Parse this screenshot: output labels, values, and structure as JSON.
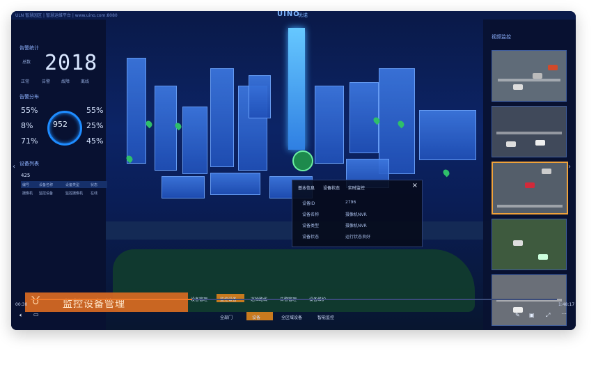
{
  "topbar": {
    "url": "ULN 智慧园区 | 智慧运维平台 | www.uino.com:8080",
    "logo": "UINO",
    "logo_sub": "优诺"
  },
  "left": {
    "section1": "告警统计",
    "year_label": "总数",
    "year": "2018",
    "legend": [
      "正常",
      "告警",
      "故障",
      "离线"
    ],
    "section2": "告警分布",
    "percentages": [
      "55%",
      "8%",
      "71%",
      "55%",
      "25%",
      "45%"
    ],
    "ring_value": "952",
    "section3": "设备列表",
    "count": "425",
    "table_headers": [
      "编号",
      "设备名称",
      "设备类型",
      "状态"
    ],
    "table_row": [
      "摄像机",
      "监控设备",
      "监控摄像机",
      "在线"
    ]
  },
  "popup": {
    "tabs": [
      "基本信息",
      "设备状态",
      "实时监控"
    ],
    "close": "×",
    "rows": [
      {
        "label": "设备ID",
        "value": "2796"
      },
      {
        "label": "设备名称",
        "value": "摄像机NVR"
      },
      {
        "label": "设备类型",
        "value": "摄像机NVR"
      },
      {
        "label": "设备状态",
        "value": "运行状态良好"
      }
    ]
  },
  "right": {
    "title": "视频监控"
  },
  "banner": {
    "text": "监控设备管理"
  },
  "bottom": {
    "menu1": [
      "设备管理",
      "监控设备",
      "巡检路线",
      "告警管理",
      "设备维护"
    ],
    "menu2": [
      "全部门",
      "设备",
      "全区域设备",
      "智能监控"
    ]
  },
  "video": {
    "time_left": "00:30",
    "time_right": "1:48:17"
  },
  "colors": {
    "accent": "#1e8cff",
    "banner": "#d96a22",
    "selected": "#f0a23a"
  }
}
